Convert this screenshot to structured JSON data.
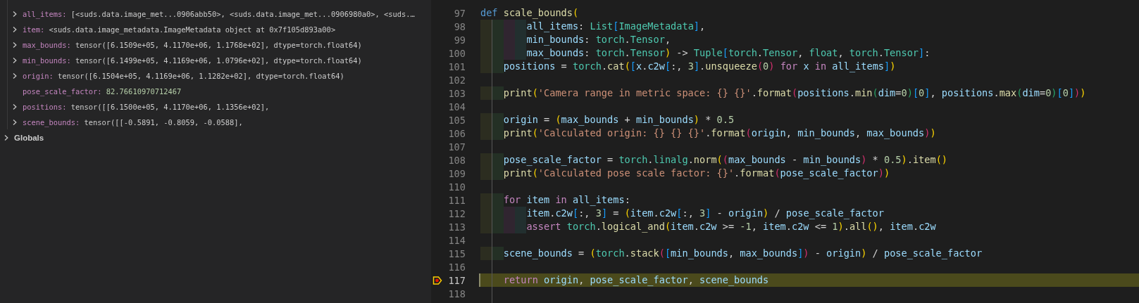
{
  "variables": {
    "locals": [
      {
        "name": "all_items:",
        "kind": "object",
        "expanded": false,
        "value": "[<suds.data.image_met...0906abb50>, <suds.data.image_met...0906980a0>, <suds.…"
      },
      {
        "name": "item:",
        "kind": "object",
        "expanded": false,
        "value": "<suds.data.image_metadata.ImageMetadata object at 0x7f105d893a00>"
      },
      {
        "name": "max_bounds:",
        "kind": "object",
        "expanded": false,
        "value": "tensor([6.1509e+05, 4.1170e+06, 1.1768e+02], dtype=torch.float64)"
      },
      {
        "name": "min_bounds:",
        "kind": "object",
        "expanded": false,
        "value": "tensor([6.1499e+05, 4.1169e+06, 1.0796e+02], dtype=torch.float64)"
      },
      {
        "name": "origin:",
        "kind": "object",
        "expanded": false,
        "value": "tensor([6.1504e+05, 4.1169e+06, 1.1282e+02], dtype=torch.float64)"
      },
      {
        "name": "pose_scale_factor:",
        "kind": "number",
        "value": "82.76610970712467"
      },
      {
        "name": "positions:",
        "kind": "object",
        "expanded": false,
        "value": "tensor([[6.1500e+05, 4.1170e+06, 1.1356e+02],"
      },
      {
        "name": "scene_bounds:",
        "kind": "object",
        "expanded": false,
        "value": "tensor([[-0.5891, -0.8059, -0.0588],"
      }
    ],
    "globals": {
      "label": "Globals",
      "expanded": false
    }
  },
  "editor": {
    "lines": [
      {
        "number": "97",
        "current": false,
        "tokens": [
          {
            "kind": "kw",
            "text": "def "
          },
          {
            "kind": "fn",
            "text": "scale_bounds"
          },
          {
            "kind": "b1",
            "text": "("
          }
        ],
        "parameters": [
          {
            "number": "98",
            "current": false,
            "tokens": [
              {
                "kind": "var",
                "text": "all_items"
              },
              {
                "kind": "op",
                "text": ": "
              },
              {
                "kind": "type",
                "text": "List"
              },
              {
                "kind": "sq",
                "text": "["
              },
              {
                "kind": "type",
                "text": "ImageMetadata"
              },
              {
                "kind": "sq",
                "text": "]"
              },
              {
                "kind": "op",
                "text": ","
              }
            ]
          },
          {
            "number": "99",
            "current": false,
            "tokens": [
              {
                "kind": "var",
                "text": "min_bounds"
              },
              {
                "kind": "op",
                "text": ": "
              },
              {
                "kind": "type",
                "text": "torch"
              },
              {
                "kind": "op",
                "text": "."
              },
              {
                "kind": "type",
                "text": "Tensor"
              },
              {
                "kind": "op",
                "text": ","
              }
            ]
          },
          {
            "number": "100",
            "current": false,
            "tokens": [
              {
                "kind": "var",
                "text": "max_bounds"
              },
              {
                "kind": "op",
                "text": ": "
              },
              {
                "kind": "type",
                "text": "torch"
              },
              {
                "kind": "op",
                "text": "."
              },
              {
                "kind": "type",
                "text": "Tensor"
              },
              {
                "kind": "b1",
                "text": ")"
              },
              {
                "kind": "op",
                "text": " -> "
              },
              {
                "kind": "type",
                "text": "Tuple"
              },
              {
                "kind": "sq",
                "text": "["
              },
              {
                "kind": "type",
                "text": "torch"
              },
              {
                "kind": "op",
                "text": "."
              },
              {
                "kind": "type",
                "text": "Tensor"
              },
              {
                "kind": "op",
                "text": ", "
              },
              {
                "kind": "type",
                "text": "float"
              },
              {
                "kind": "op",
                "text": ", "
              },
              {
                "kind": "type",
                "text": "torch"
              },
              {
                "kind": "op",
                "text": "."
              },
              {
                "kind": "type",
                "text": "Tensor"
              },
              {
                "kind": "sq",
                "text": "]"
              },
              {
                "kind": "op",
                "text": ":"
              }
            ]
          }
        ],
        "children": [
          {
            "number": "101",
            "current": false,
            "tokens": [
              {
                "kind": "var",
                "text": "positions"
              },
              {
                "kind": "op",
                "text": " = "
              },
              {
                "kind": "type",
                "text": "torch"
              },
              {
                "kind": "op",
                "text": "."
              },
              {
                "kind": "fn",
                "text": "cat"
              },
              {
                "kind": "b1",
                "text": "("
              },
              {
                "kind": "sq",
                "text": "["
              },
              {
                "kind": "var",
                "text": "x"
              },
              {
                "kind": "op",
                "text": "."
              },
              {
                "kind": "var",
                "text": "c2w"
              },
              {
                "kind": "sq",
                "text": "["
              },
              {
                "kind": "op",
                "text": ":, "
              },
              {
                "kind": "num",
                "text": "3"
              },
              {
                "kind": "sq",
                "text": "]"
              },
              {
                "kind": "op",
                "text": "."
              },
              {
                "kind": "fn",
                "text": "unsqueeze"
              },
              {
                "kind": "b2",
                "text": "("
              },
              {
                "kind": "num",
                "text": "0"
              },
              {
                "kind": "b2",
                "text": ") "
              },
              {
                "kind": "ctl",
                "text": "for "
              },
              {
                "kind": "var",
                "text": "x "
              },
              {
                "kind": "ctl",
                "text": "in "
              },
              {
                "kind": "var",
                "text": "all_items"
              },
              {
                "kind": "sq",
                "text": "]"
              },
              {
                "kind": "b1",
                "text": ")"
              }
            ]
          },
          {
            "number": "102",
            "current": false
          },
          {
            "number": "103",
            "current": false,
            "tokens": [
              {
                "kind": "fn",
                "text": "print"
              },
              {
                "kind": "b1",
                "text": "("
              },
              {
                "kind": "str",
                "text": "'Camera range in metric space: {} {}'"
              },
              {
                "kind": "op",
                "text": "."
              },
              {
                "kind": "fn",
                "text": "format"
              },
              {
                "kind": "b2",
                "text": "("
              },
              {
                "kind": "var",
                "text": "positions"
              },
              {
                "kind": "op",
                "text": "."
              },
              {
                "kind": "fn",
                "text": "min"
              },
              {
                "kind": "b3",
                "text": "("
              },
              {
                "kind": "var",
                "text": "dim"
              },
              {
                "kind": "op",
                "text": "="
              },
              {
                "kind": "num",
                "text": "0"
              },
              {
                "kind": "b3",
                "text": ")"
              },
              {
                "kind": "sq",
                "text": "["
              },
              {
                "kind": "num",
                "text": "0"
              },
              {
                "kind": "sq",
                "text": "]"
              },
              {
                "kind": "op",
                "text": ", "
              },
              {
                "kind": "var",
                "text": "positions"
              },
              {
                "kind": "op",
                "text": "."
              },
              {
                "kind": "fn",
                "text": "max"
              },
              {
                "kind": "b3",
                "text": "("
              },
              {
                "kind": "var",
                "text": "dim"
              },
              {
                "kind": "op",
                "text": "="
              },
              {
                "kind": "num",
                "text": "0"
              },
              {
                "kind": "b3",
                "text": ")"
              },
              {
                "kind": "sq",
                "text": "["
              },
              {
                "kind": "num",
                "text": "0"
              },
              {
                "kind": "sq",
                "text": "]"
              },
              {
                "kind": "b2",
                "text": ")"
              },
              {
                "kind": "b1",
                "text": ")"
              }
            ]
          },
          {
            "number": "104",
            "current": false
          },
          {
            "number": "105",
            "current": false,
            "tokens": [
              {
                "kind": "var",
                "text": "origin"
              },
              {
                "kind": "op",
                "text": " = "
              },
              {
                "kind": "b1",
                "text": "("
              },
              {
                "kind": "var",
                "text": "max_bounds"
              },
              {
                "kind": "op",
                "text": " + "
              },
              {
                "kind": "var",
                "text": "min_bounds"
              },
              {
                "kind": "b1",
                "text": ")"
              },
              {
                "kind": "op",
                "text": " * "
              },
              {
                "kind": "num",
                "text": "0.5"
              }
            ]
          },
          {
            "number": "106",
            "current": false,
            "tokens": [
              {
                "kind": "fn",
                "text": "print"
              },
              {
                "kind": "b1",
                "text": "("
              },
              {
                "kind": "str",
                "text": "'Calculated origin: {} {} {}'"
              },
              {
                "kind": "op",
                "text": "."
              },
              {
                "kind": "fn",
                "text": "format"
              },
              {
                "kind": "b2",
                "text": "("
              },
              {
                "kind": "var",
                "text": "origin"
              },
              {
                "kind": "op",
                "text": ", "
              },
              {
                "kind": "var",
                "text": "min_bounds"
              },
              {
                "kind": "op",
                "text": ", "
              },
              {
                "kind": "var",
                "text": "max_bounds"
              },
              {
                "kind": "b2",
                "text": ")"
              },
              {
                "kind": "b1",
                "text": ")"
              }
            ]
          },
          {
            "number": "107",
            "current": false
          },
          {
            "number": "108",
            "current": false,
            "tokens": [
              {
                "kind": "var",
                "text": "pose_scale_factor"
              },
              {
                "kind": "op",
                "text": " = "
              },
              {
                "kind": "type",
                "text": "torch"
              },
              {
                "kind": "op",
                "text": "."
              },
              {
                "kind": "type",
                "text": "linalg"
              },
              {
                "kind": "op",
                "text": "."
              },
              {
                "kind": "fn",
                "text": "norm"
              },
              {
                "kind": "b1",
                "text": "("
              },
              {
                "kind": "b2",
                "text": "("
              },
              {
                "kind": "var",
                "text": "max_bounds"
              },
              {
                "kind": "op",
                "text": " - "
              },
              {
                "kind": "var",
                "text": "min_bounds"
              },
              {
                "kind": "b2",
                "text": ")"
              },
              {
                "kind": "op",
                "text": " * "
              },
              {
                "kind": "num",
                "text": "0.5"
              },
              {
                "kind": "b1",
                "text": ")"
              },
              {
                "kind": "op",
                "text": "."
              },
              {
                "kind": "fn",
                "text": "item"
              },
              {
                "kind": "b1",
                "text": "()"
              }
            ]
          },
          {
            "number": "109",
            "current": false,
            "tokens": [
              {
                "kind": "fn",
                "text": "print"
              },
              {
                "kind": "b1",
                "text": "("
              },
              {
                "kind": "str",
                "text": "'Calculated pose scale factor: {}'"
              },
              {
                "kind": "op",
                "text": "."
              },
              {
                "kind": "fn",
                "text": "format"
              },
              {
                "kind": "b2",
                "text": "("
              },
              {
                "kind": "var",
                "text": "pose_scale_factor"
              },
              {
                "kind": "b2",
                "text": ")"
              },
              {
                "kind": "b1",
                "text": ")"
              }
            ]
          },
          {
            "number": "110",
            "current": false
          },
          {
            "number": "111",
            "current": false,
            "tokens": [
              {
                "kind": "ctl",
                "text": "for "
              },
              {
                "kind": "var",
                "text": "item "
              },
              {
                "kind": "ctl",
                "text": "in "
              },
              {
                "kind": "var",
                "text": "all_items"
              },
              {
                "kind": "op",
                "text": ":"
              }
            ],
            "children": [
              {
                "number": "112",
                "current": false,
                "tokens": [
                  {
                    "kind": "var",
                    "text": "item"
                  },
                  {
                    "kind": "op",
                    "text": "."
                  },
                  {
                    "kind": "var",
                    "text": "c2w"
                  },
                  {
                    "kind": "sq",
                    "text": "["
                  },
                  {
                    "kind": "op",
                    "text": ":, "
                  },
                  {
                    "kind": "num",
                    "text": "3"
                  },
                  {
                    "kind": "sq",
                    "text": "]"
                  },
                  {
                    "kind": "op",
                    "text": " = "
                  },
                  {
                    "kind": "b1",
                    "text": "("
                  },
                  {
                    "kind": "var",
                    "text": "item"
                  },
                  {
                    "kind": "op",
                    "text": "."
                  },
                  {
                    "kind": "var",
                    "text": "c2w"
                  },
                  {
                    "kind": "sq",
                    "text": "["
                  },
                  {
                    "kind": "op",
                    "text": ":, "
                  },
                  {
                    "kind": "num",
                    "text": "3"
                  },
                  {
                    "kind": "sq",
                    "text": "]"
                  },
                  {
                    "kind": "op",
                    "text": " - "
                  },
                  {
                    "kind": "var",
                    "text": "origin"
                  },
                  {
                    "kind": "b1",
                    "text": ")"
                  },
                  {
                    "kind": "op",
                    "text": " / "
                  },
                  {
                    "kind": "var",
                    "text": "pose_scale_factor"
                  }
                ]
              },
              {
                "number": "113",
                "current": false,
                "tokens": [
                  {
                    "kind": "ctl",
                    "text": "assert "
                  },
                  {
                    "kind": "type",
                    "text": "torch"
                  },
                  {
                    "kind": "op",
                    "text": "."
                  },
                  {
                    "kind": "fn",
                    "text": "logical_and"
                  },
                  {
                    "kind": "b1",
                    "text": "("
                  },
                  {
                    "kind": "var",
                    "text": "item"
                  },
                  {
                    "kind": "op",
                    "text": "."
                  },
                  {
                    "kind": "var",
                    "text": "c2w"
                  },
                  {
                    "kind": "op",
                    "text": " >= "
                  },
                  {
                    "kind": "num",
                    "text": "-1"
                  },
                  {
                    "kind": "op",
                    "text": ", "
                  },
                  {
                    "kind": "var",
                    "text": "item"
                  },
                  {
                    "kind": "op",
                    "text": "."
                  },
                  {
                    "kind": "var",
                    "text": "c2w"
                  },
                  {
                    "kind": "op",
                    "text": " <= "
                  },
                  {
                    "kind": "num",
                    "text": "1"
                  },
                  {
                    "kind": "b1",
                    "text": ")"
                  },
                  {
                    "kind": "op",
                    "text": "."
                  },
                  {
                    "kind": "fn",
                    "text": "all"
                  },
                  {
                    "kind": "b1",
                    "text": "()"
                  },
                  {
                    "kind": "op",
                    "text": ", "
                  },
                  {
                    "kind": "var",
                    "text": "item"
                  },
                  {
                    "kind": "op",
                    "text": "."
                  },
                  {
                    "kind": "var",
                    "text": "c2w"
                  }
                ]
              }
            ]
          },
          {
            "number": "114",
            "current": false
          },
          {
            "number": "115",
            "current": false,
            "tokens": [
              {
                "kind": "var",
                "text": "scene_bounds"
              },
              {
                "kind": "op",
                "text": " = "
              },
              {
                "kind": "b1",
                "text": "("
              },
              {
                "kind": "type",
                "text": "torch"
              },
              {
                "kind": "op",
                "text": "."
              },
              {
                "kind": "fn",
                "text": "stack"
              },
              {
                "kind": "b2",
                "text": "("
              },
              {
                "kind": "sq",
                "text": "["
              },
              {
                "kind": "var",
                "text": "min_bounds"
              },
              {
                "kind": "op",
                "text": ", "
              },
              {
                "kind": "var",
                "text": "max_bounds"
              },
              {
                "kind": "sq",
                "text": "]"
              },
              {
                "kind": "b2",
                "text": ")"
              },
              {
                "kind": "op",
                "text": " - "
              },
              {
                "kind": "var",
                "text": "origin"
              },
              {
                "kind": "b1",
                "text": ")"
              },
              {
                "kind": "op",
                "text": " / "
              },
              {
                "kind": "var",
                "text": "pose_scale_factor"
              }
            ]
          },
          {
            "number": "116",
            "current": false
          },
          {
            "number": "117",
            "current": true,
            "tokens": [
              {
                "kind": "ctl",
                "text": "return "
              },
              {
                "kind": "var",
                "text": "origin"
              },
              {
                "kind": "op",
                "text": ", "
              },
              {
                "kind": "var",
                "text": "pose_scale_factor"
              },
              {
                "kind": "op",
                "text": ", "
              },
              {
                "kind": "var",
                "text": "scene_bounds"
              }
            ]
          },
          {
            "number": "118",
            "current": false
          }
        ]
      }
    ]
  }
}
